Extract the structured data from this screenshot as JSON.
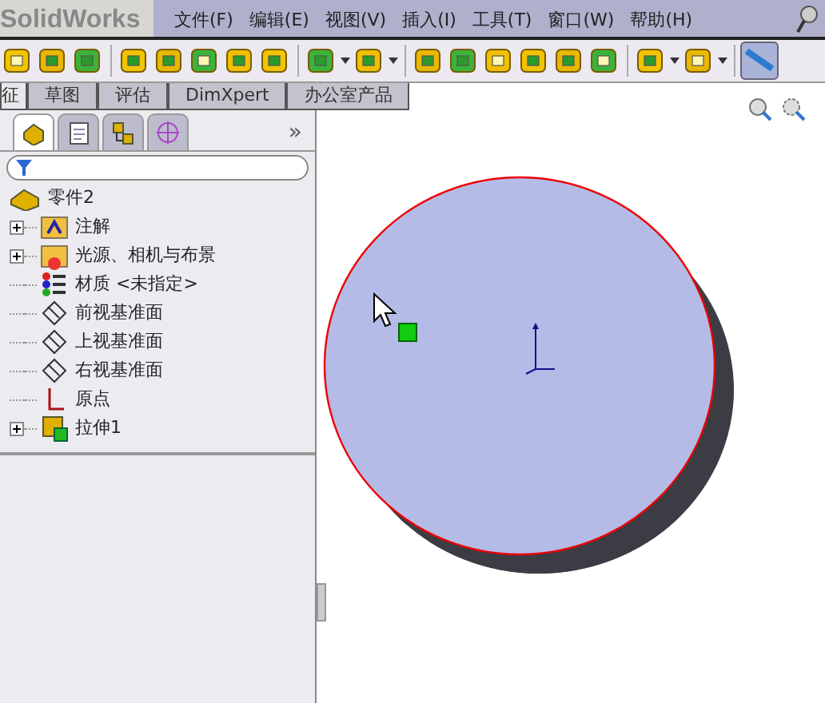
{
  "app": {
    "logo": "SolidWorks"
  },
  "menu": [
    {
      "label": "文件(F)"
    },
    {
      "label": "编辑(E)"
    },
    {
      "label": "视图(V)"
    },
    {
      "label": "插入(I)"
    },
    {
      "label": "工具(T)"
    },
    {
      "label": "窗口(W)"
    },
    {
      "label": "帮助(H)"
    }
  ],
  "toolbar": [
    {
      "kind": "tool"
    },
    {
      "kind": "tool"
    },
    {
      "kind": "tool"
    },
    {
      "kind": "sep"
    },
    {
      "kind": "tool"
    },
    {
      "kind": "tool"
    },
    {
      "kind": "tool"
    },
    {
      "kind": "tool"
    },
    {
      "kind": "tool"
    },
    {
      "kind": "sep"
    },
    {
      "kind": "drop"
    },
    {
      "kind": "drop"
    },
    {
      "kind": "sep"
    },
    {
      "kind": "tool"
    },
    {
      "kind": "tool"
    },
    {
      "kind": "tool"
    },
    {
      "kind": "tool"
    },
    {
      "kind": "tool"
    },
    {
      "kind": "tool"
    },
    {
      "kind": "sep"
    },
    {
      "kind": "drop"
    },
    {
      "kind": "drop"
    },
    {
      "kind": "sep"
    },
    {
      "kind": "toggle"
    }
  ],
  "tabs": [
    {
      "label": "征",
      "selected": true
    },
    {
      "label": "草图",
      "selected": false
    },
    {
      "label": "评估",
      "selected": false
    },
    {
      "label": "DimXpert",
      "selected": false
    },
    {
      "label": "办公室产品",
      "selected": false
    }
  ],
  "panel_tabs": [
    {
      "selected": true
    },
    {
      "selected": false
    },
    {
      "selected": false
    },
    {
      "selected": false
    }
  ],
  "panel_more": "»",
  "tree": {
    "label": "零件2",
    "children": [
      {
        "label": "注解",
        "kind": "annotations",
        "expandable": true
      },
      {
        "label": "光源、相机与布景",
        "kind": "lights",
        "expandable": true
      },
      {
        "label": "材质 <未指定>",
        "kind": "material",
        "expandable": false
      },
      {
        "label": "前视基准面",
        "kind": "plane",
        "expandable": false
      },
      {
        "label": "上视基准面",
        "kind": "plane",
        "expandable": false
      },
      {
        "label": "右视基准面",
        "kind": "plane",
        "expandable": false
      },
      {
        "label": "原点",
        "kind": "origin",
        "expandable": false
      },
      {
        "label": "拉伸1",
        "kind": "extrude",
        "expandable": true
      }
    ]
  }
}
